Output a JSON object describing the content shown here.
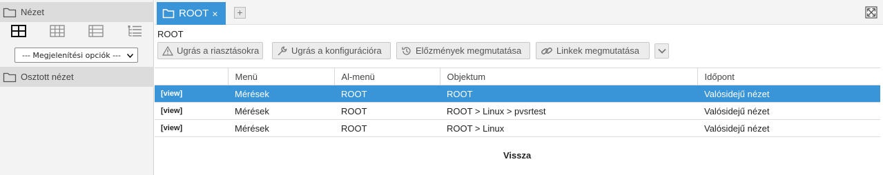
{
  "sidebar": {
    "view_header": "Nézet",
    "display_options": "--- Megjelenítési opciók ---",
    "shared_header": "Osztott nézet",
    "view_icons": [
      "grid-2x2-icon",
      "grid-3x3-icon",
      "list-view-icon",
      "tree-view-icon"
    ]
  },
  "tabs": {
    "active_label": "ROOT",
    "close_symbol": "×",
    "add_symbol": "+"
  },
  "breadcrumb": "ROOT",
  "toolbar": {
    "alerts": "Ugrás a riasztásokra",
    "config": "Ugrás a konfigurációra",
    "history": "Előzmények megmutatása",
    "links": "Linkek megmutatása"
  },
  "table": {
    "headers": [
      "",
      "Menü",
      "Al-menü",
      "Objektum",
      "Időpont"
    ],
    "rows": [
      {
        "view": "[view]",
        "menu": "Mérések",
        "submenu": "ROOT",
        "object": "ROOT",
        "time": "Valósidejű nézet"
      },
      {
        "view": "[view]",
        "menu": "Mérések",
        "submenu": "ROOT",
        "object": "ROOT > Linux > pvsrtest",
        "time": "Valósidejű nézet"
      },
      {
        "view": "[view]",
        "menu": "Mérések",
        "submenu": "ROOT",
        "object": "ROOT > Linux",
        "time": "Valósidejű nézet"
      }
    ]
  },
  "back_label": "Vissza",
  "colors": {
    "accent": "#3a95d8",
    "sidebar_bg": "#f3f3f3",
    "header_bg": "#dcdcdc"
  }
}
